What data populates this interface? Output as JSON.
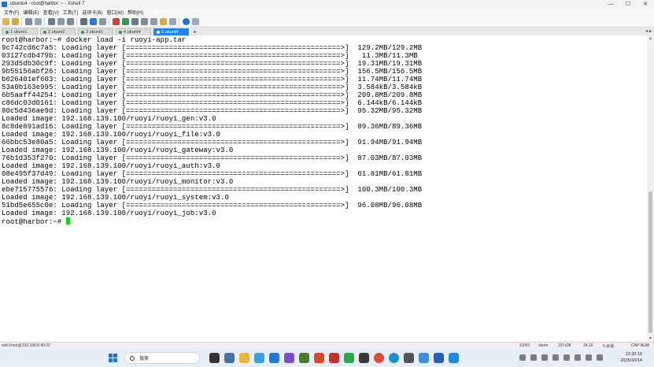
{
  "window": {
    "title": "ubuntu4 - root@harbor: ~ - Xshell 7",
    "buttons": {
      "minimize": "—",
      "maximize": "☐",
      "close": "✕"
    }
  },
  "menu": [
    "文件(F)",
    "编辑(E)",
    "查看(V)",
    "工具(T)",
    "选项卡(B)",
    "窗口(W)",
    "帮助(H)"
  ],
  "tabs": [
    {
      "label": "1 ubunt1",
      "active": false
    },
    {
      "label": "2 ubunt2",
      "active": false
    },
    {
      "label": "3 ubunt3",
      "active": false
    },
    {
      "label": "4 ubunt4",
      "active": false
    },
    {
      "label": "5 ubunt4",
      "active": true
    }
  ],
  "terminal": {
    "lines": [
      "root@harbor:~# docker load -i ruoyi-app.tar",
      "9c742cd6c7a5: Loading layer [==================================================>]  129.2MB/129.2MB",
      "03127cdb479b: Loading layer [==================================================>]   11.3MB/11.3MB",
      "293d5db30c9f: Loading layer [==================================================>]  19.31MB/19.31MB",
      "9b55156abf26: Loading layer [==================================================>]  156.5MB/156.5MB",
      "b626401ef603: Loading layer [==================================================>]  11.74MB/11.74MB",
      "53a0b163e995: Loading layer [==================================================>]  3.584kB/3.584kB",
      "6b5aaff44254: Loading layer [==================================================>]  209.8MB/209.8MB",
      "c86dc03d0161: Loading layer [==================================================>]  6.144kB/6.144kB",
      "80c5d436ae9d: Loading layer [==================================================>]  95.32MB/95.32MB",
      "Loaded image: 192.168.139.100/ruoyi/ruoyi_gen:v3.0",
      "8c8de691ad16: Loading layer [==================================================>]  89.36MB/89.36MB",
      "Loaded image: 192.168.139.100/ruoyi/ruoyi_file:v3.0",
      "66bbc53e80a5: Loading layer [==================================================>]  91.94MB/91.94MB",
      "Loaded image: 192.168.139.100/ruoyi/ruoyi_gateway:v3.0",
      "76b1d353f270: Loading layer [==================================================>]  87.03MB/87.03MB",
      "Loaded image: 192.168.139.100/ruoyi/ruoyi_auth:v3.0",
      "08e495f37d49: Loading layer [==================================================>]  61.81MB/61.81MB",
      "Loaded image: 192.168.139.100/ruoyi/ruoyi_monitor:v3.0",
      "ebe715775576: Loading layer [==================================================>]  100.3MB/100.3MB",
      "Loaded image: 192.168.139.100/ruoyi/ruoyi_system:v3.0",
      "51bd5e655c0e: Loading layer [==================================================>]  96.08MB/96.08MB",
      "Loaded image: 192.168.139.100/ruoyi/ruoyi_job:v3.0"
    ],
    "prompt": "root@harbor:~# ",
    "cursor_color": "#17d117"
  },
  "statusbar": {
    "connection": "ssh://root@192.168.8.40:22",
    "protocol": "SSH2",
    "terminal_type": "xterm",
    "size": "157x38",
    "position": "24,16",
    "sessions": "5 会话",
    "caps": "CAP NUM"
  },
  "taskbar": {
    "search_placeholder": "搜索",
    "time": "13:32:16",
    "date": "2025/10/14"
  },
  "colors": {
    "active_tab": "#1f86e8",
    "cursor": "#17d117",
    "start_button": "#1976d2"
  }
}
